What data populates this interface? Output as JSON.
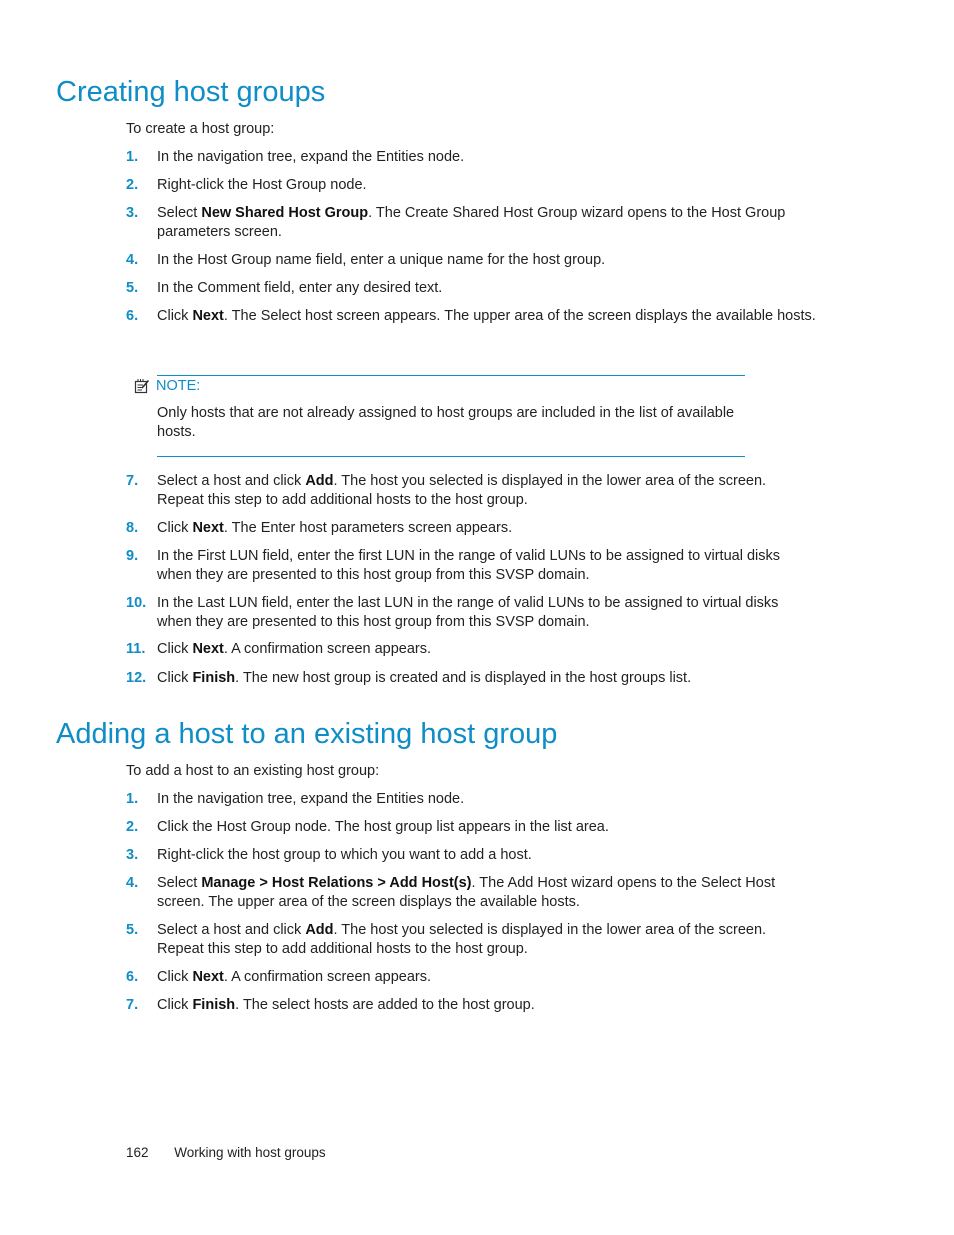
{
  "section1": {
    "title": "Creating host groups",
    "intro": "To create a host group:",
    "steps_a": [
      {
        "num": "1.",
        "parts": [
          {
            "t": "In the navigation tree, expand the Entities node."
          }
        ]
      },
      {
        "num": "2.",
        "parts": [
          {
            "t": "Right-click the Host Group node."
          }
        ]
      },
      {
        "num": "3.",
        "parts": [
          {
            "t": "Select "
          },
          {
            "b": "New Shared Host Group"
          },
          {
            "t": ". The Create Shared Host Group wizard opens to the Host Group parameters screen."
          }
        ]
      },
      {
        "num": "4.",
        "parts": [
          {
            "t": "In the Host Group name field, enter a unique name for the host group."
          }
        ]
      },
      {
        "num": "5.",
        "parts": [
          {
            "t": "In the Comment field, enter any desired text."
          }
        ]
      },
      {
        "num": "6.",
        "parts": [
          {
            "t": "Click "
          },
          {
            "b": "Next"
          },
          {
            "t": ". The Select host screen appears. The upper area of the screen displays the available hosts."
          }
        ]
      }
    ],
    "note": {
      "icon": "note-icon",
      "label": "NOTE:",
      "text": "Only hosts that are not already assigned to host groups are included in the list of available hosts."
    },
    "steps_b": [
      {
        "num": "7.",
        "parts": [
          {
            "t": "Select a host and click "
          },
          {
            "b": "Add"
          },
          {
            "t": ". The host you selected is displayed in the lower area of the screen. Repeat this step to add additional hosts to the host group."
          }
        ]
      },
      {
        "num": "8.",
        "parts": [
          {
            "t": "Click "
          },
          {
            "b": "Next"
          },
          {
            "t": ". The Enter host parameters screen appears."
          }
        ]
      },
      {
        "num": "9.",
        "parts": [
          {
            "t": "In the First LUN field, enter the first LUN in the range of valid LUNs to be assigned to virtual disks when they are presented to this host group from this SVSP domain."
          }
        ]
      },
      {
        "num": "10.",
        "parts": [
          {
            "t": "In the Last LUN field, enter the last LUN in the range of valid LUNs to be assigned to virtual disks when they are presented to this host group from this SVSP domain."
          }
        ]
      },
      {
        "num": "11.",
        "parts": [
          {
            "t": "Click "
          },
          {
            "b": "Next"
          },
          {
            "t": ". A confirmation screen appears."
          }
        ]
      },
      {
        "num": "12.",
        "parts": [
          {
            "t": "Click "
          },
          {
            "b": "Finish"
          },
          {
            "t": ". The new host group is created and is displayed in the host groups list."
          }
        ]
      }
    ]
  },
  "section2": {
    "title": "Adding a host to an existing host group",
    "intro": "To add a host to an existing host group:",
    "steps": [
      {
        "num": "1.",
        "parts": [
          {
            "t": "In the navigation tree, expand the Entities node."
          }
        ]
      },
      {
        "num": "2.",
        "parts": [
          {
            "t": "Click the Host Group node. The host group list appears in the list area."
          }
        ]
      },
      {
        "num": "3.",
        "parts": [
          {
            "t": "Right-click the host group to which you want to add a host."
          }
        ]
      },
      {
        "num": "4.",
        "parts": [
          {
            "t": "Select "
          },
          {
            "b": "Manage > Host Relations > Add Host(s)"
          },
          {
            "t": ". The Add Host wizard opens to the Select Host screen. The upper area of the screen displays the available hosts."
          }
        ]
      },
      {
        "num": "5.",
        "parts": [
          {
            "t": "Select a host and click "
          },
          {
            "b": "Add"
          },
          {
            "t": ". The host you selected is displayed in the lower area of the screen. Repeat this step to add additional hosts to the host group."
          }
        ]
      },
      {
        "num": "6.",
        "parts": [
          {
            "t": "Click "
          },
          {
            "b": "Next"
          },
          {
            "t": ". A confirmation screen appears."
          }
        ]
      },
      {
        "num": "7.",
        "parts": [
          {
            "t": "Click "
          },
          {
            "b": "Finish"
          },
          {
            "t": ". The select hosts are added to the host group."
          }
        ]
      }
    ]
  },
  "footer": {
    "page_number": "162",
    "chapter": "Working with host groups"
  }
}
